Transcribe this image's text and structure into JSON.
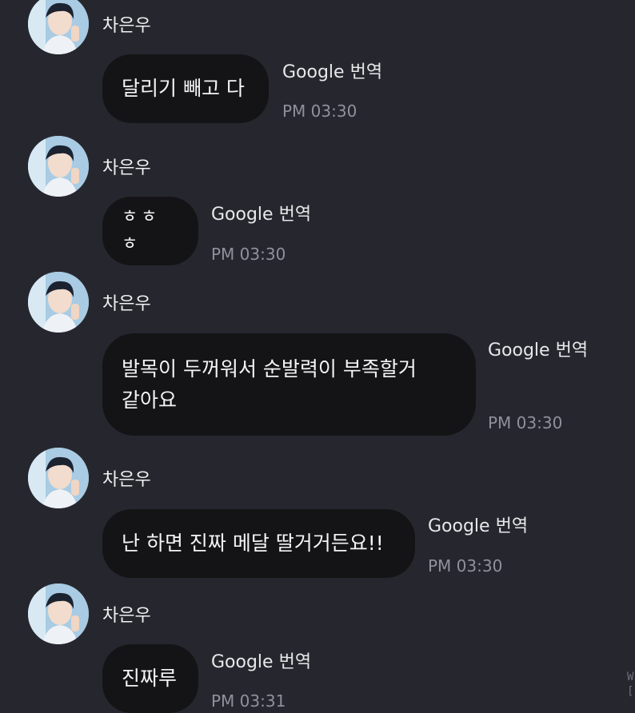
{
  "chat": {
    "messages": [
      {
        "sender": "차은우",
        "text": "달리기 빼고 다",
        "translate": "Google 번역",
        "time": "PM 03:30"
      },
      {
        "sender": "차은우",
        "text": "ㅎㅎㅎ",
        "translate": "Google 번역",
        "time": "PM 03:30"
      },
      {
        "sender": "차은우",
        "text": "발목이 두꺼워서 순발력이 부족할거\n같아요",
        "translate": "Google 번역",
        "time": "PM 03:30"
      },
      {
        "sender": "차은우",
        "text": "난 하면 진짜 메달 딸거거든요!!",
        "translate": "Google 번역",
        "time": "PM 03:30"
      },
      {
        "sender": "차은우",
        "text": "진짜루",
        "translate": "Google 번역",
        "time": "PM 03:31"
      }
    ]
  },
  "colors": {
    "background": "#26272e",
    "bubble": "#141416",
    "text": "#f4f4f6",
    "time": "#8f909b"
  },
  "icons": {
    "avatar": "profile-photo"
  },
  "edge": {
    "text": "W\n["
  }
}
